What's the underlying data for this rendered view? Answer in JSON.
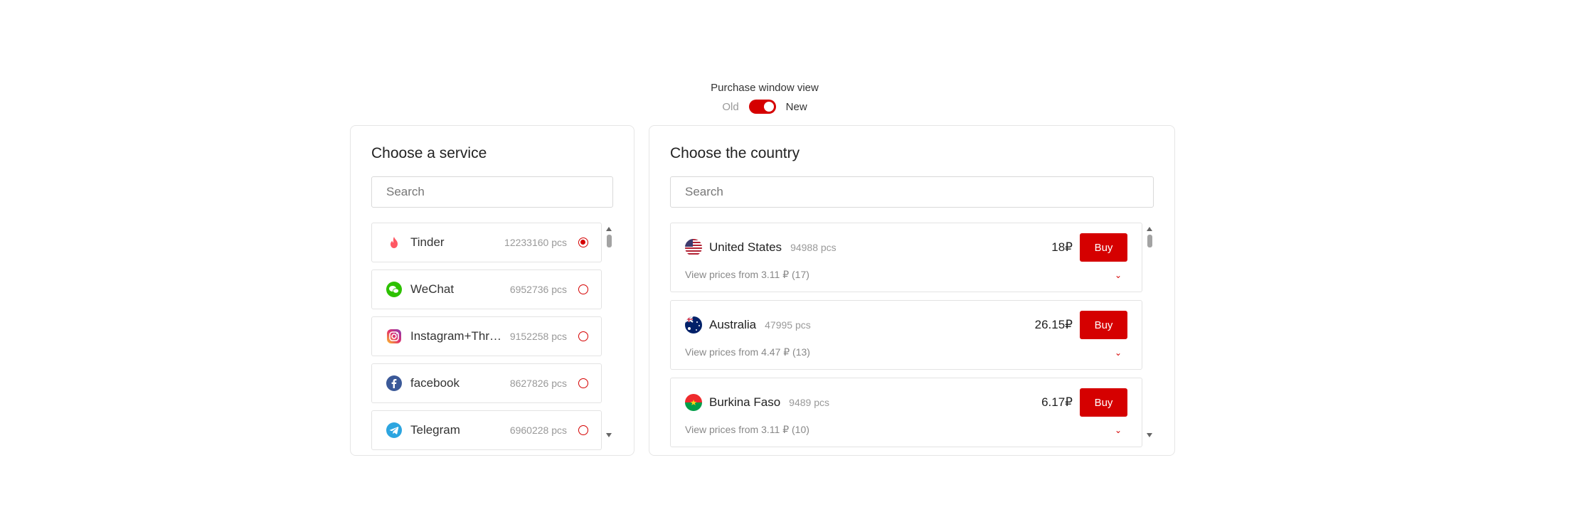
{
  "toggle": {
    "title": "Purchase window view",
    "old_label": "Old",
    "new_label": "New",
    "state": "new"
  },
  "services": {
    "title": "Choose a service",
    "search_placeholder": "Search",
    "items": [
      {
        "name": "Tinder",
        "count": "12233160 pcs",
        "selected": true,
        "icon": "tinder-icon",
        "color": "#ff5864"
      },
      {
        "name": "WeChat",
        "count": "6952736 pcs",
        "selected": false,
        "icon": "wechat-icon",
        "color": "#2dc100"
      },
      {
        "name": "Instagram+Thre...",
        "count": "9152258 pcs",
        "selected": false,
        "icon": "instagram-icon",
        "color": "#d6249f"
      },
      {
        "name": "facebook",
        "count": "8627826 pcs",
        "selected": false,
        "icon": "facebook-icon",
        "color": "#3b5998"
      },
      {
        "name": "Telegram",
        "count": "6960228 pcs",
        "selected": false,
        "icon": "telegram-icon",
        "color": "#2ca5e0"
      }
    ]
  },
  "countries": {
    "title": "Choose the country",
    "search_placeholder": "Search",
    "buy_label": "Buy",
    "items": [
      {
        "name": "United States",
        "count": "94988 pcs",
        "price": "18₽",
        "prices_text": "View prices from 3.11 ₽ (17)",
        "flag": "us-flag-icon"
      },
      {
        "name": "Australia",
        "count": "47995 pcs",
        "price": "26.15₽",
        "prices_text": "View prices from 4.47 ₽ (13)",
        "flag": "au-flag-icon"
      },
      {
        "name": "Burkina Faso",
        "count": "9489 pcs",
        "price": "6.17₽",
        "prices_text": "View prices from 3.11 ₽ (10)",
        "flag": "bf-flag-icon"
      }
    ]
  },
  "colors": {
    "accent": "#d50000"
  }
}
